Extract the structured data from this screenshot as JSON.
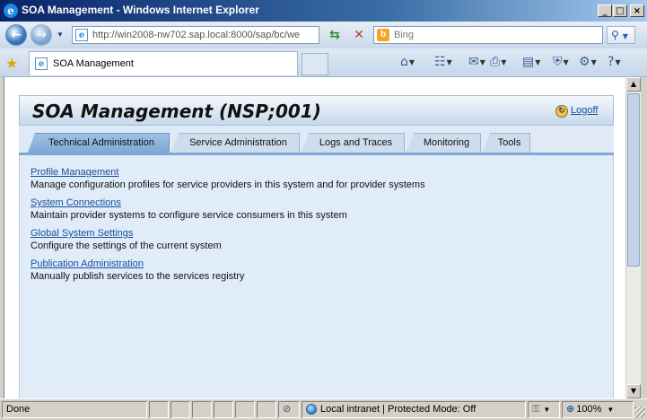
{
  "window": {
    "title": "SOA Management - Windows Internet Explorer",
    "controls": {
      "minimize": "_",
      "maximize": "□",
      "close": "×"
    }
  },
  "address_bar": {
    "url": "http://win2008-nw702.sap.local:8000/sap/bc/we",
    "search_placeholder": "Bing"
  },
  "browser_tab": {
    "label": "SOA Management"
  },
  "page": {
    "title": "SOA Management (NSP;001)",
    "logoff_label": "Logoff",
    "tabs": [
      {
        "label": "Technical Administration",
        "active": true
      },
      {
        "label": "Service Administration",
        "active": false
      },
      {
        "label": "Logs and Traces",
        "active": false
      },
      {
        "label": "Monitoring",
        "active": false
      },
      {
        "label": "Tools",
        "active": false
      }
    ],
    "items": [
      {
        "link": "Profile Management",
        "description": "Manage configuration profiles for service providers in this system and for provider systems"
      },
      {
        "link": "System Connections",
        "description": "Maintain provider systems to configure service consumers in this system"
      },
      {
        "link": "Global System Settings",
        "description": "Configure the settings of the current system"
      },
      {
        "link": "Publication Administration",
        "description": "Manually publish services to the services registry"
      }
    ]
  },
  "status_bar": {
    "status": "Done",
    "zone": "Local intranet | Protected Mode: Off",
    "zoom": "100%"
  },
  "colors": {
    "accent": "#7fa8d6",
    "link": "#1a4fa0",
    "page_background": "#e0ecf8"
  }
}
